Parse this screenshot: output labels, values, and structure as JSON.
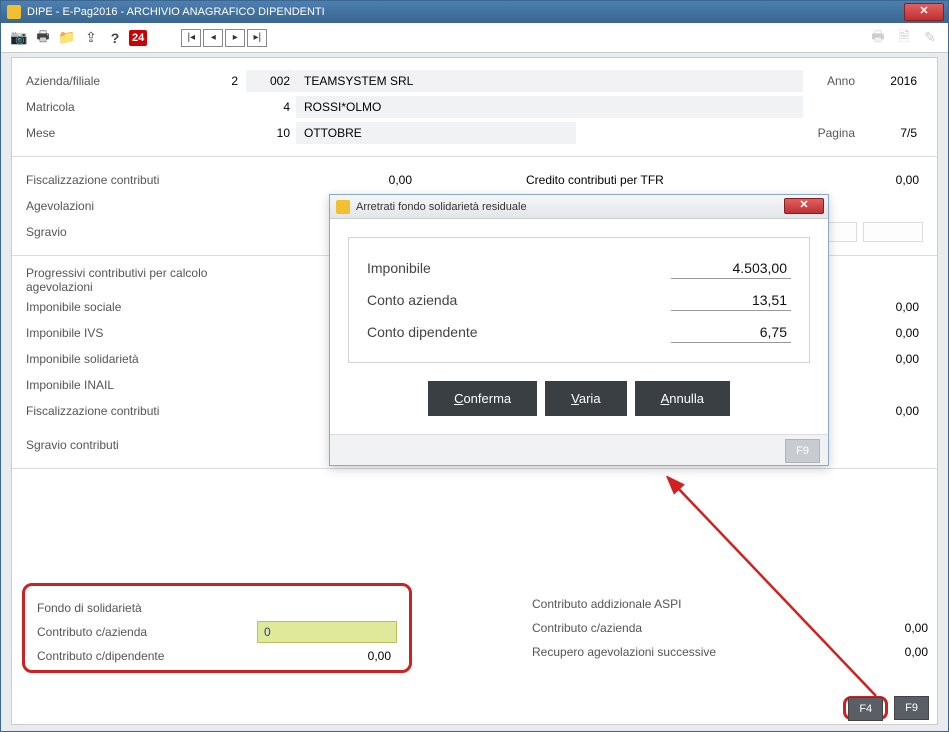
{
  "window": {
    "title": "DIPE  -  E-Pag2016   -   ARCHIVIO ANAGRAFICO DIPENDENTI",
    "close_glyph": "✕"
  },
  "toolbar": {
    "badge": "24"
  },
  "header": {
    "azienda_label": "Azienda/filiale",
    "azienda_num1": "2",
    "azienda_num2": "002",
    "azienda_name": "TEAMSYSTEM SRL",
    "anno_label": "Anno",
    "anno": "2016",
    "matricola_label": "Matricola",
    "matricola_num": "4",
    "matricola_name": "ROSSI*OLMO",
    "mese_label": "Mese",
    "mese_num": "10",
    "mese_name": "OTTOBRE",
    "pagina_label": "Pagina",
    "pagina": "7/5"
  },
  "sec_fisc": {
    "fiscalizzazione_label": "Fiscalizzazione contributi",
    "fiscalizzazione_val": "0,00",
    "credito_label": "Credito contributi per TFR",
    "credito_val": "0,00",
    "agevolazioni_label": "Agevolazioni",
    "sgravio_label": "Sgravio"
  },
  "sec_prog": {
    "title": "Progressivi contributivi per calcolo agevolazioni",
    "imp_sociale": "Imponibile sociale",
    "imp_ivs": "Imponibile IVS",
    "imp_solid": "Imponibile solidarietà",
    "imp_inail": "Imponibile INAIL",
    "fisc_contr": "Fiscalizzazione contributi",
    "sgravio_contr": "Sgravio contributi",
    "r_val": "0,00"
  },
  "fondo": {
    "title": "Fondo di solidarietà",
    "azienda_label": "Contributo c/azienda",
    "azienda_val": "0",
    "dip_label": "Contributo c/dipendente",
    "dip_val": "0,00"
  },
  "aspi": {
    "title": "Contributo addizionale ASPI",
    "azienda_label": "Contributo c/azienda",
    "azienda_val": "0,00",
    "recupero_label": "Recupero agevolazioni successive",
    "recupero_val": "0,00"
  },
  "modal": {
    "title": "Arretrati fondo solidarietà residuale",
    "imponibile_label": "Imponibile",
    "imponibile_val": "4.503,00",
    "azienda_label": "Conto azienda",
    "azienda_val": "13,51",
    "dip_label": "Conto dipendente",
    "dip_val": "6,75",
    "conferma": "Conferma",
    "varia": "Varia",
    "annulla": "Annulla",
    "f9": "F9",
    "close_glyph": "✕"
  },
  "footer": {
    "f4": "F4",
    "f9": "F9"
  }
}
